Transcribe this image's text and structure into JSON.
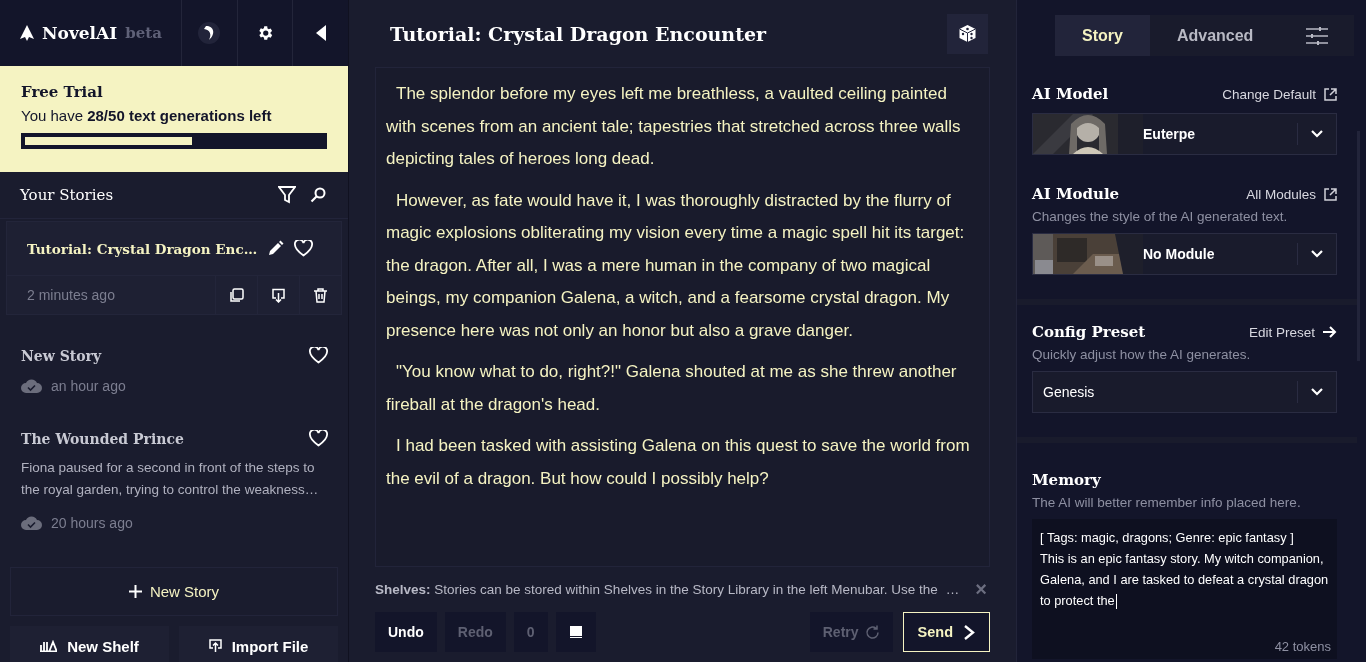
{
  "app": {
    "logo": "NovelAI",
    "badge": "beta"
  },
  "trial": {
    "title": "Free Trial",
    "text": "You have **28/50 text generations left**",
    "level": 0.56
  },
  "library": {
    "title": "Your Stories"
  },
  "stories": [
    {
      "title": "Tutorial: Crystal Dragon Enc…",
      "time": "2 minutes ago",
      "selected": true
    },
    {
      "title": "New Story",
      "time": "an hour ago",
      "selected": false
    },
    {
      "title": "The Wounded Prince",
      "snippet": "Fiona paused for a second in front of the steps to the royal garden, trying to control the weakness…",
      "time": "20 hours ago",
      "selected": false
    }
  ],
  "new_story_button": "New Story",
  "new_shelf_button": "New Shelf",
  "import_button": "Import File",
  "editor": {
    "title": "Tutorial: Crystal Dragon Encounter",
    "paragraphs": [
      "The splendor before my eyes left me breathless, a vaulted ceiling painted with scenes from an ancient tale; tapestries that stretched across three walls depicting tales of heroes long dead.",
      "However, as fate would have it, I was thoroughly distracted by the flurry of magic explosions obliterating my vision every time a magic spell hit its target: the dragon. After all, I was a mere human in the company of two magical beings, my companion Galena, a witch, and a fearsome crystal dragon. My presence here was not only an honor but also a grave danger.",
      "\"You know what to do, right?!\" Galena shouted at me as she threw another fireball at the dragon's head.",
      "I had been tasked with assisting Galena on this quest to save the world from the evil of a dragon. But how could I possibly help?"
    ]
  },
  "tip": {
    "text": "**Shelves:** Stories can be stored within Shelves in the Story Library in the left Menubar. Use the",
    "ellipsis": "…",
    "close": "×"
  },
  "controls": [
    {
      "kind": "text",
      "label": "Undo",
      "disabled": false
    },
    {
      "kind": "text",
      "label": "Redo",
      "disabled": true
    },
    {
      "kind": "text",
      "label": "0",
      "disabled": true
    },
    {
      "kind": "book"
    }
  ],
  "retry_button": {
    "label": "Retry",
    "disabled": true
  },
  "send_button": {
    "label": "Send",
    "disabled": false
  },
  "tabs": [
    {
      "label": "Story",
      "selected": true
    },
    {
      "label": "Advanced",
      "selected": false
    }
  ],
  "model": {
    "title": "AI Model",
    "link": "Change Default",
    "value": "Euterpe"
  },
  "module": {
    "title": "AI Module",
    "link": "All Modules",
    "description": "Changes the style of the AI generated text.",
    "value": "No Module"
  },
  "preset": {
    "title": "Config Preset",
    "link": "Edit Preset",
    "description": "Quickly adjust how the AI generates.",
    "value": "Genesis"
  },
  "memory": {
    "title": "Memory",
    "description": "The AI will better remember info placed here.",
    "text": "[ Tags: magic, dragons; Genre: epic fantasy ]\nThis is an epic fantasy story. My witch companion, Galena, and I are tasked to defeat a crystal dragon to protect the",
    "tokens": "42 tokens"
  }
}
